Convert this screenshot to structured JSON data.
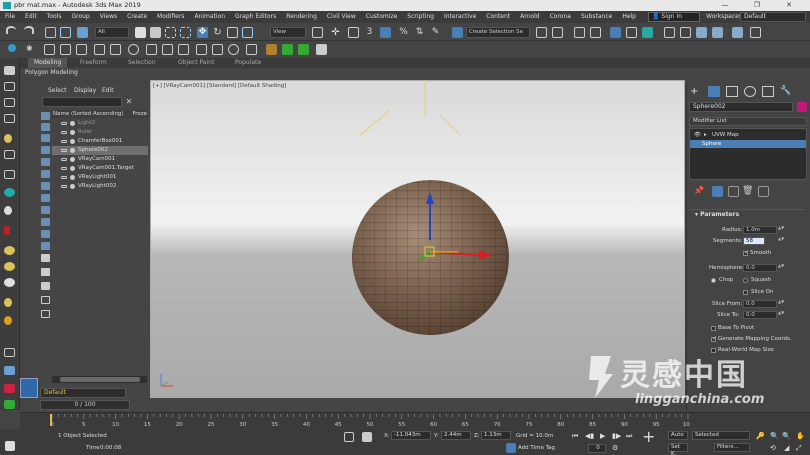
{
  "window": {
    "title": "pbr mat.max - Autodesk 3ds Max 2019",
    "buttons": [
      "—",
      "❐",
      "✕"
    ]
  },
  "menubar": {
    "items": [
      "File",
      "Edit",
      "Tools",
      "Group",
      "Views",
      "Create",
      "Modifiers",
      "Animation",
      "Graph Editors",
      "Rendering",
      "Civil View",
      "Customize",
      "Scripting",
      "Interactive",
      "Content",
      "Arnold",
      "Corona",
      "Substance",
      "Help"
    ],
    "signin": "Sign In",
    "workspaces_label": "Workspaces:",
    "workspaces_value": "Default"
  },
  "toolbar": {
    "filter_value": "All",
    "view_value": "View",
    "selection_set_placeholder": "Create Selection Se"
  },
  "ribbon": {
    "tabs": [
      "Modeling",
      "Freeform",
      "Selection",
      "Object Paint",
      "Populate"
    ],
    "subtab": "Polygon Modeling"
  },
  "explorer": {
    "menu": [
      "Select",
      "Display",
      "Edit"
    ],
    "header_name": "Name (Sorted Ascending)",
    "header_frozen": "Froze",
    "rows": [
      {
        "name": "Light2",
        "dim": true,
        "selected": false
      },
      {
        "name": "Ruler",
        "dim": true,
        "selected": false
      },
      {
        "name": "ChamferBox001",
        "dim": false,
        "selected": false
      },
      {
        "name": "Sphere002",
        "dim": false,
        "selected": true
      },
      {
        "name": "VRayCam001",
        "dim": false,
        "selected": false
      },
      {
        "name": "VRayCam001.Target",
        "dim": false,
        "selected": false
      },
      {
        "name": "VRayLight001",
        "dim": false,
        "selected": false
      },
      {
        "name": "VRayLight002",
        "dim": false,
        "selected": false
      }
    ],
    "layer": "Default",
    "frame_counter": "0 / 100"
  },
  "viewport": {
    "label": "[+] [VRayCam001] [Standard] [Default Shading]"
  },
  "command_panel": {
    "object_name": "Sphere002",
    "object_color": "#c4177c",
    "modifier_list": "Modifier List",
    "stack": [
      {
        "label": "UVW Map",
        "selected": false
      },
      {
        "label": "Sphere",
        "selected": true
      }
    ],
    "params_title": "Parameters",
    "radius_label": "Radius:",
    "radius_value": "1.0m",
    "segments_label": "Segments:",
    "segments_value": "58",
    "smooth_label": "Smooth",
    "hemisphere_label": "Hemisphere:",
    "hemisphere_value": "0.0",
    "chop_label": "Chop",
    "squash_label": "Squash",
    "slice_on_label": "Slice On",
    "slice_from_label": "Slice From:",
    "slice_from_value": "0.0",
    "slice_to_label": "Slice To:",
    "slice_to_value": "0.0",
    "base_to_pivot_label": "Base To Pivot",
    "gen_mapping_label": "Generate Mapping Coords.",
    "real_world_label": "Real-World Map Size"
  },
  "timeline": {
    "ticks": [
      "0",
      "5",
      "10",
      "15",
      "20",
      "25",
      "30",
      "35",
      "40",
      "45",
      "50",
      "55",
      "60",
      "65",
      "70",
      "75",
      "80",
      "85",
      "90",
      "95",
      "100"
    ]
  },
  "status": {
    "selected_text": "1 Object Selected",
    "time_label": "Time",
    "time_value": "0:00:08",
    "x_label": "X:",
    "x_value": "-11.043m",
    "y_label": "Y:",
    "y_value": "2.44m",
    "z_label": "Z:",
    "z_value": "1.13m",
    "grid_text": "Grid = 10.0m",
    "add_time_tag": "Add Time Tag",
    "auto_label": "Auto",
    "selected_dropdown": "Selected",
    "setk_label": "Set K.",
    "filters_label": "Filters...",
    "frame_value": "0"
  },
  "watermark": {
    "cn": "灵感中国",
    "en": "lingganchina.com"
  }
}
